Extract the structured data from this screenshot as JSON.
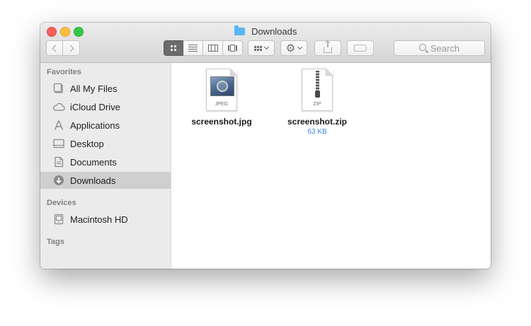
{
  "window": {
    "title": "Downloads"
  },
  "toolbar": {
    "search_placeholder": "Search"
  },
  "sidebar": {
    "favorites_heading": "Favorites",
    "favorites": [
      {
        "label": "All My Files",
        "icon": "all-files-icon"
      },
      {
        "label": "iCloud Drive",
        "icon": "cloud-icon"
      },
      {
        "label": "Applications",
        "icon": "applications-icon"
      },
      {
        "label": "Desktop",
        "icon": "desktop-icon"
      },
      {
        "label": "Documents",
        "icon": "documents-icon"
      },
      {
        "label": "Downloads",
        "icon": "downloads-icon",
        "selected": true
      }
    ],
    "devices_heading": "Devices",
    "devices": [
      {
        "label": "Macintosh HD",
        "icon": "hard-drive-icon"
      }
    ],
    "tags_heading": "Tags"
  },
  "files": [
    {
      "name": "screenshot.jpg",
      "badge": "JPEG",
      "icon": "jpeg-file-icon"
    },
    {
      "name": "screenshot.zip",
      "badge": "ZIP",
      "size": "63 KB",
      "icon": "zip-file-icon"
    }
  ],
  "colors": {
    "selection": "#cfcfcf",
    "accent": "#3b86d6",
    "sidebar": "#ebebeb"
  }
}
